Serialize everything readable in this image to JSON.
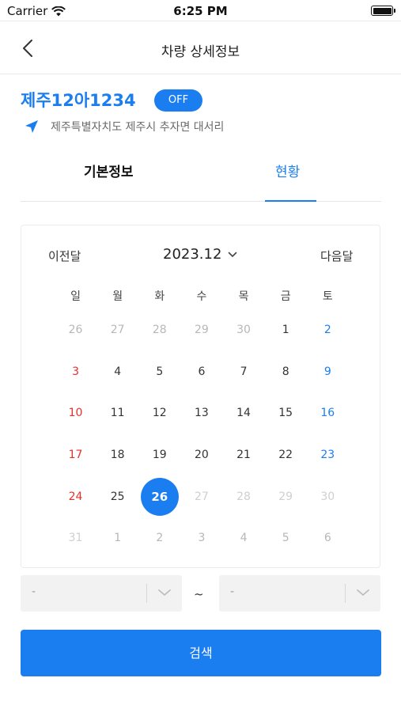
{
  "status_bar": {
    "carrier": "Carrier",
    "time": "6:25 PM"
  },
  "nav": {
    "title": "차량 상세정보"
  },
  "vehicle": {
    "plate": "제주12아1234",
    "toggle_label": "OFF",
    "location": "제주특별자치도 제주시 추자면 대서리"
  },
  "tabs": [
    {
      "label": "기본정보",
      "active": false
    },
    {
      "label": "현황",
      "active": true
    }
  ],
  "calendar": {
    "prev_label": "이전달",
    "next_label": "다음달",
    "month_label": "2023.12",
    "weekdays": [
      "일",
      "월",
      "화",
      "수",
      "목",
      "금",
      "토"
    ],
    "selected_day": "26",
    "weeks": [
      [
        {
          "d": "26",
          "t": "other"
        },
        {
          "d": "27",
          "t": "other"
        },
        {
          "d": "28",
          "t": "other"
        },
        {
          "d": "29",
          "t": "other"
        },
        {
          "d": "30",
          "t": "other"
        },
        {
          "d": "1",
          "t": "normal"
        },
        {
          "d": "2",
          "t": "sat"
        }
      ],
      [
        {
          "d": "3",
          "t": "sun"
        },
        {
          "d": "4",
          "t": "normal"
        },
        {
          "d": "5",
          "t": "normal"
        },
        {
          "d": "6",
          "t": "normal"
        },
        {
          "d": "7",
          "t": "normal"
        },
        {
          "d": "8",
          "t": "normal"
        },
        {
          "d": "9",
          "t": "sat"
        }
      ],
      [
        {
          "d": "10",
          "t": "sun"
        },
        {
          "d": "11",
          "t": "normal"
        },
        {
          "d": "12",
          "t": "normal"
        },
        {
          "d": "13",
          "t": "normal"
        },
        {
          "d": "14",
          "t": "normal"
        },
        {
          "d": "15",
          "t": "normal"
        },
        {
          "d": "16",
          "t": "sat"
        }
      ],
      [
        {
          "d": "17",
          "t": "sun"
        },
        {
          "d": "18",
          "t": "normal"
        },
        {
          "d": "19",
          "t": "normal"
        },
        {
          "d": "20",
          "t": "normal"
        },
        {
          "d": "21",
          "t": "normal"
        },
        {
          "d": "22",
          "t": "normal"
        },
        {
          "d": "23",
          "t": "sat"
        }
      ],
      [
        {
          "d": "24",
          "t": "sun"
        },
        {
          "d": "25",
          "t": "normal"
        },
        {
          "d": "26",
          "t": "sel"
        },
        {
          "d": "27",
          "t": "future"
        },
        {
          "d": "28",
          "t": "future"
        },
        {
          "d": "29",
          "t": "future"
        },
        {
          "d": "30",
          "t": "future"
        }
      ],
      [
        {
          "d": "31",
          "t": "future"
        },
        {
          "d": "1",
          "t": "other"
        },
        {
          "d": "2",
          "t": "other"
        },
        {
          "d": "3",
          "t": "other"
        },
        {
          "d": "4",
          "t": "other"
        },
        {
          "d": "5",
          "t": "other"
        },
        {
          "d": "6",
          "t": "other"
        }
      ]
    ]
  },
  "range": {
    "start_value": "-",
    "separator": "~",
    "end_value": "-"
  },
  "search_button": "검색",
  "colors": {
    "accent": "#1b7ef0",
    "sunday": "#e4312e",
    "saturday": "#1b7ef0"
  },
  "icons": {
    "back": "chevron-left-icon",
    "location": "navigation-arrow-icon",
    "dropdown": "chevron-down-icon"
  }
}
